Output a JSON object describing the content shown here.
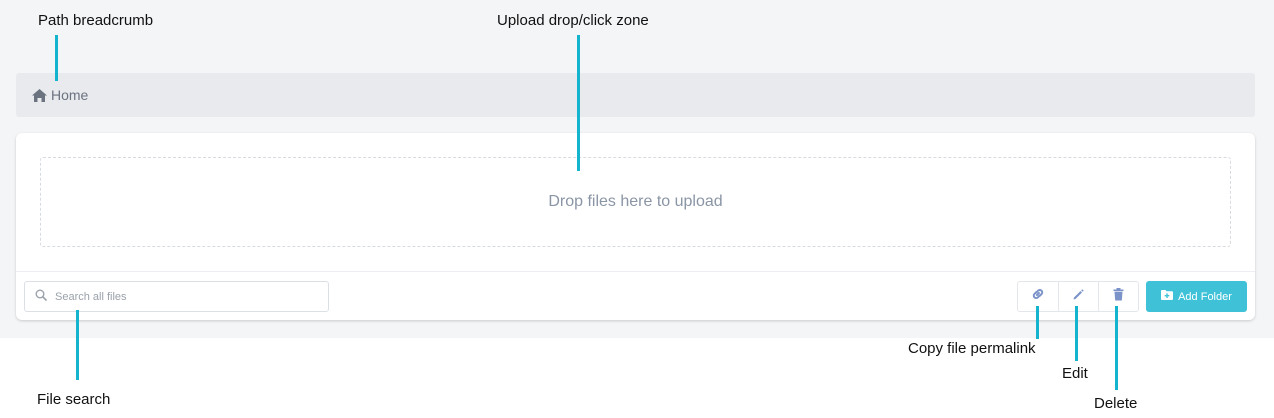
{
  "breadcrumb": {
    "home_label": "Home",
    "home_icon": "home-icon"
  },
  "upload": {
    "dropzone_text": "Drop files here to upload"
  },
  "search": {
    "placeholder": "Search all files",
    "icon": "search-icon"
  },
  "toolbar": {
    "copy_permalink_icon": "link-icon",
    "edit_icon": "pencil-icon",
    "delete_icon": "trash-icon",
    "add_folder_label": "Add Folder",
    "add_folder_icon": "folder-plus-icon"
  },
  "annotations": {
    "breadcrumb": "Path breadcrumb",
    "upload": "Upload drop/click zone",
    "search": "File search",
    "permalink": "Copy file permalink",
    "edit": "Edit",
    "delete": "Delete"
  },
  "colors": {
    "accent": "#3fc2d8",
    "callout_line": "#14b4ce",
    "icon_blue": "#7b93c9"
  }
}
